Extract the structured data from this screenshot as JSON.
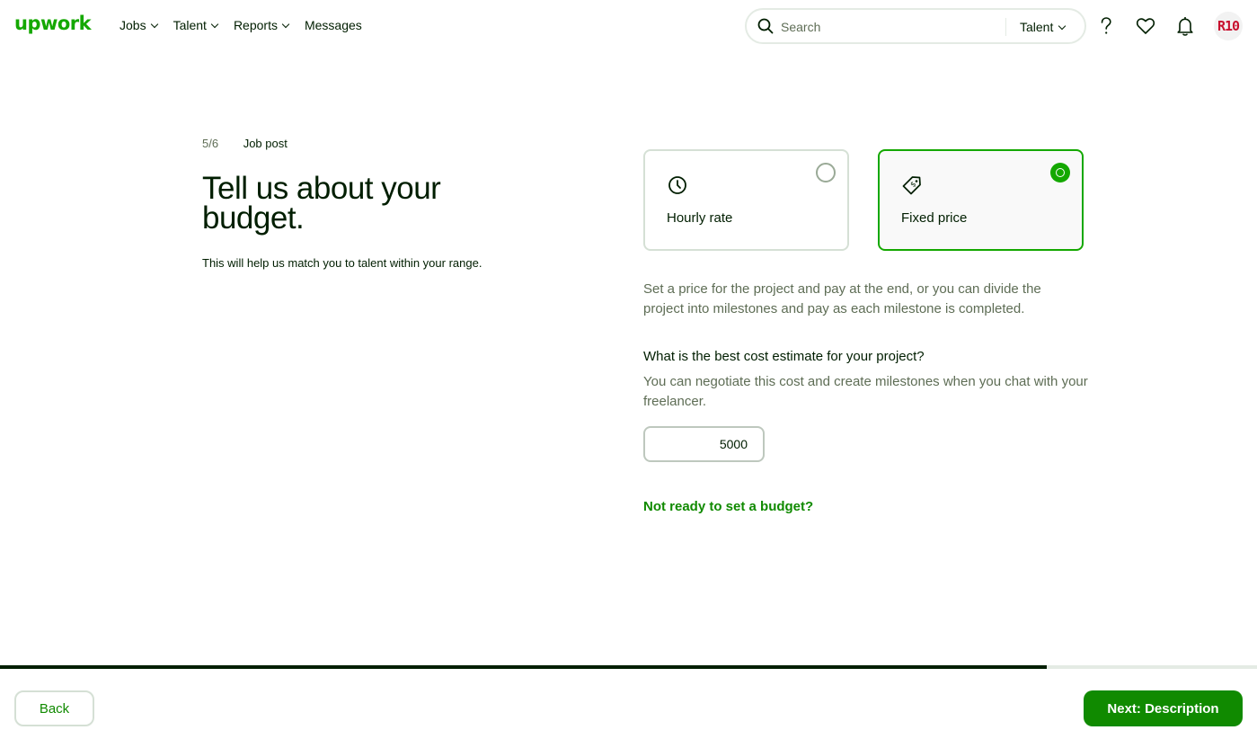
{
  "header": {
    "logo": "upwork",
    "nav": [
      {
        "label": "Jobs",
        "has_dropdown": true
      },
      {
        "label": "Talent",
        "has_dropdown": true
      },
      {
        "label": "Reports",
        "has_dropdown": true
      },
      {
        "label": "Messages",
        "has_dropdown": false
      }
    ],
    "search": {
      "placeholder": "Search",
      "scope": "Talent"
    },
    "icons": [
      "help-icon",
      "heart-icon",
      "notification-bell-icon"
    ],
    "avatar_text": "R10"
  },
  "intro": {
    "step": "5/6",
    "step_label": "Job post",
    "title": "Tell us about your budget.",
    "subtitle": "This will help us match you to talent within your range."
  },
  "options": [
    {
      "label": "Hourly rate",
      "icon": "clock-icon",
      "selected": false
    },
    {
      "label": "Fixed price",
      "icon": "price-tag-icon",
      "selected": true
    }
  ],
  "fixed": {
    "description": "Set a price for the project and pay at the end, or you can divide the project into milestones and pay as each milestone is completed.",
    "question": "What is the best cost estimate for your project?",
    "hint": "You can negotiate this cost and create milestones when you chat with your freelancer.",
    "value": "5000",
    "not_ready_link": "Not ready to set a budget?"
  },
  "footer": {
    "progress_fraction": 0.833,
    "back_label": "Back",
    "next_label": "Next: Description"
  },
  "colors": {
    "brand_green": "#14a800",
    "link_green": "#108a00",
    "text": "#001e00",
    "muted": "#5e6d55",
    "avatar_red": "#c8102e"
  }
}
